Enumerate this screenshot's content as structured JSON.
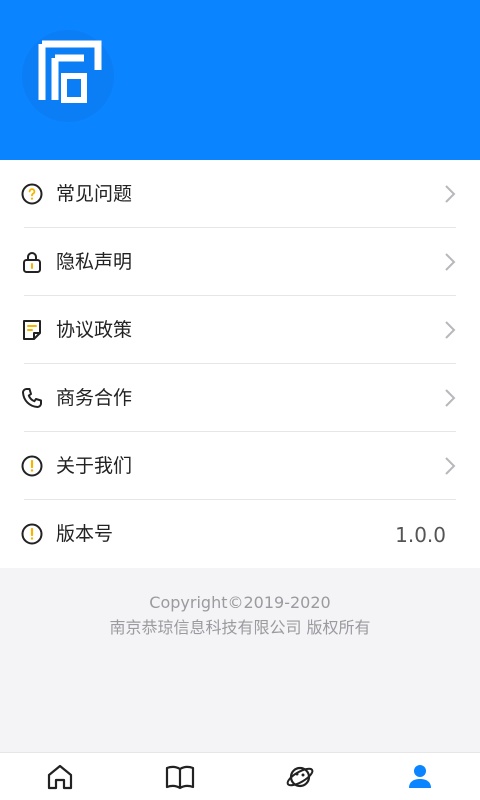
{
  "menu": {
    "items": [
      {
        "label": "常见问题",
        "icon": "question-circle-icon"
      },
      {
        "label": "隐私声明",
        "icon": "lock-icon"
      },
      {
        "label": "协议政策",
        "icon": "document-icon"
      },
      {
        "label": "商务合作",
        "icon": "phone-icon"
      },
      {
        "label": "关于我们",
        "icon": "info-circle-icon"
      }
    ],
    "version": {
      "label": "版本号",
      "value": "1.0.0",
      "icon": "info-circle-icon"
    }
  },
  "footer": {
    "line1": "Copyright©2019-2020",
    "line2": "南京恭琼信息科技有限公司 版权所有"
  },
  "tabbar": {
    "tabs": [
      {
        "name": "home",
        "icon": "home-icon"
      },
      {
        "name": "book",
        "icon": "book-icon"
      },
      {
        "name": "explore",
        "icon": "planet-icon"
      },
      {
        "name": "profile",
        "icon": "user-icon",
        "active": true
      }
    ]
  },
  "colors": {
    "brand": "#0a84ff",
    "accent_yellow": "#f6b400",
    "text": "#222222",
    "muted": "#9a9a9f"
  }
}
